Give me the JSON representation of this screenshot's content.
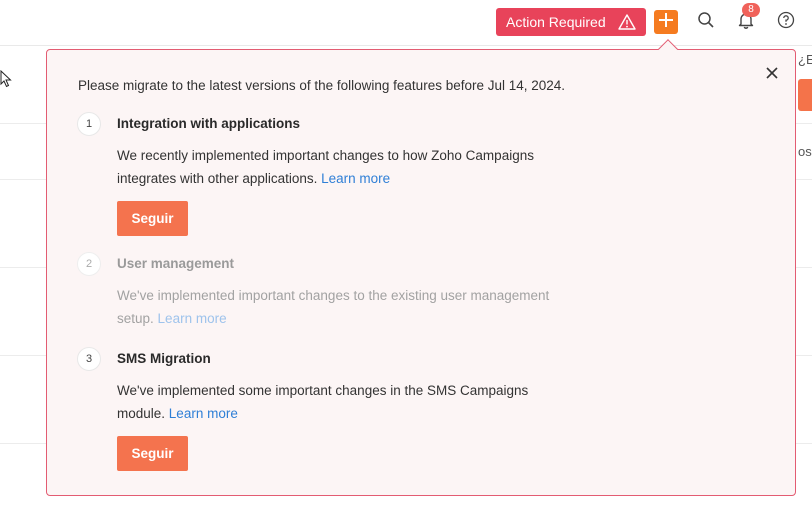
{
  "header": {
    "action_required_label": "Action Required",
    "notifications_count": "8",
    "icons": [
      "warning-icon",
      "plus-icon",
      "search-icon",
      "bell-icon",
      "help-icon"
    ]
  },
  "background": {
    "right_text_top": "¿E",
    "right_text_mid": "os"
  },
  "popup": {
    "intro": "Please migrate to the latest versions of the following features before Jul 14, 2024.",
    "steps": [
      {
        "number": "1",
        "title": "Integration with applications",
        "description": "We recently implemented important changes to how Zoho Campaigns integrates with other applications.",
        "learn_more": "Learn more",
        "button_label": "Seguir",
        "enabled": true
      },
      {
        "number": "2",
        "title": "User management",
        "description": "We've implemented important changes to the existing user management setup.",
        "learn_more": "Learn more",
        "enabled": false
      },
      {
        "number": "3",
        "title": "SMS Migration",
        "description": "We've implemented some important changes in the SMS Campaigns module.",
        "learn_more": "Learn more",
        "button_label": "Seguir",
        "enabled": true
      }
    ]
  },
  "colors": {
    "accent_red": "#e8435a",
    "accent_orange": "#f4734e",
    "link_blue": "#2f7fd6",
    "popup_bg": "#fcf5f5"
  }
}
